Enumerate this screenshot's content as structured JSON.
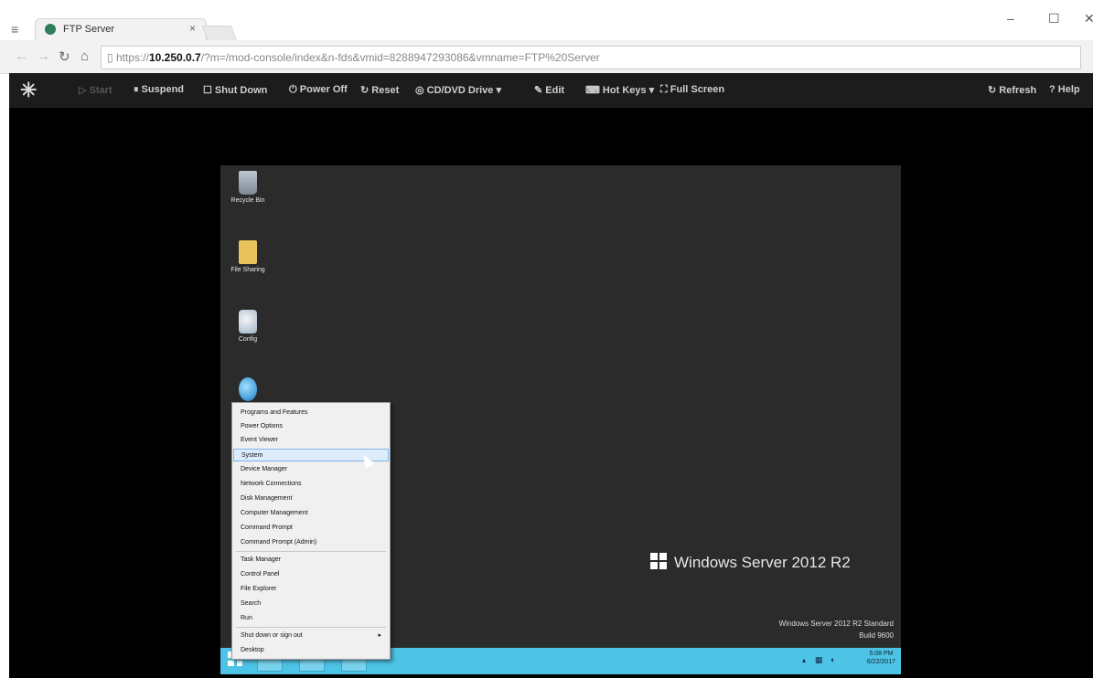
{
  "browser": {
    "tab_title": "FTP Server",
    "tab_close": "×",
    "url_prefix": "https://",
    "url_host": "10.250.0.7",
    "url_path": "/?m=/mod-console/index&n-fds&vmid=8288947293086&vmname=FTP%20Server",
    "controls": {
      "minimize": "–",
      "maximize": "☐",
      "close": "✕"
    }
  },
  "toolbar": {
    "start": "▷ Start",
    "suspend": "⏸ Suspend",
    "shutdown": "☐ Shut Down",
    "poweroff": "⏻ Power Off",
    "reset": "↻ Reset",
    "cddvd": "◎ CD/DVD Drive ▾",
    "edit": "✎ Edit",
    "hotkeys": "⌨ Hot Keys ▾",
    "fullscreen": "⛶ Full Screen",
    "refresh": "↻ Refresh",
    "help": "? Help"
  },
  "desktop": {
    "icons": [
      {
        "label": "Recycle Bin"
      },
      {
        "label": "File Sharing"
      },
      {
        "label": "Config"
      },
      {
        "label": ""
      }
    ],
    "branding": "Windows Server 2012 R2",
    "edition_line1": "Windows Server 2012 R2 Standard",
    "edition_line2": "Build 9600"
  },
  "taskbar": {
    "time": "5:08 PM",
    "date": "6/22/2017"
  },
  "context_menu": {
    "items": [
      "Programs and Features",
      "Power Options",
      "Event Viewer",
      "System",
      "Device Manager",
      "Network Connections",
      "Disk Management",
      "Computer Management",
      "Command Prompt",
      "Command Prompt (Admin)",
      "Task Manager",
      "Control Panel",
      "File Explorer",
      "Search",
      "Run",
      "Shut down or sign out",
      "Desktop"
    ],
    "highlighted": "System"
  }
}
